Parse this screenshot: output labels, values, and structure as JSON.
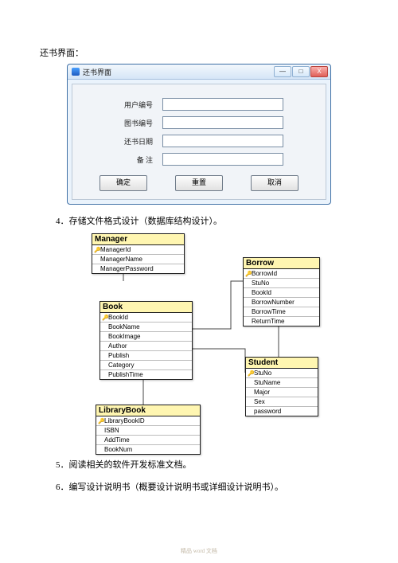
{
  "heading1": "还书界面：",
  "window": {
    "title": "还书界面",
    "fields": [
      {
        "label": "用户编号"
      },
      {
        "label": "图书编号"
      },
      {
        "label": "还书日期"
      },
      {
        "label": "备 注"
      }
    ],
    "buttons": {
      "ok": "确定",
      "reset": "重置",
      "cancel": "取消"
    },
    "sys": {
      "min": "—",
      "max": "□",
      "close": "X"
    }
  },
  "section4": "4．存储文件格式设计（数据库结构设计）。",
  "entities": {
    "manager": {
      "name": "Manager",
      "cols": [
        {
          "key": true,
          "name": "ManagerId"
        },
        {
          "key": false,
          "name": "ManagerName"
        },
        {
          "key": false,
          "name": "ManagerPassword"
        }
      ]
    },
    "borrow": {
      "name": "Borrow",
      "cols": [
        {
          "key": true,
          "name": "BorrowId"
        },
        {
          "key": false,
          "name": "StuNo"
        },
        {
          "key": false,
          "name": "BookId"
        },
        {
          "key": false,
          "name": "BorrowNumber"
        },
        {
          "key": false,
          "name": "BorrowTime"
        },
        {
          "key": false,
          "name": "ReturnTime"
        }
      ]
    },
    "book": {
      "name": "Book",
      "cols": [
        {
          "key": true,
          "name": "BookId"
        },
        {
          "key": false,
          "name": "BookName"
        },
        {
          "key": false,
          "name": "BookImage"
        },
        {
          "key": false,
          "name": "Author"
        },
        {
          "key": false,
          "name": "Publish"
        },
        {
          "key": false,
          "name": "Category"
        },
        {
          "key": false,
          "name": "PublishTime"
        }
      ]
    },
    "student": {
      "name": "Student",
      "cols": [
        {
          "key": true,
          "name": "StuNo"
        },
        {
          "key": false,
          "name": "StuName"
        },
        {
          "key": false,
          "name": "Major"
        },
        {
          "key": false,
          "name": "Sex"
        },
        {
          "key": false,
          "name": "password"
        }
      ]
    },
    "library": {
      "name": "LibraryBook",
      "cols": [
        {
          "key": true,
          "name": "LibraryBookID"
        },
        {
          "key": false,
          "name": "ISBN"
        },
        {
          "key": false,
          "name": "AddTime"
        },
        {
          "key": false,
          "name": "BookNum"
        }
      ]
    }
  },
  "section5": "5．阅读相关的软件开发标准文档。",
  "section6": "6．编写设计说明书（概要设计说明书或详细设计说明书）。",
  "footer": "精品 word 文档"
}
